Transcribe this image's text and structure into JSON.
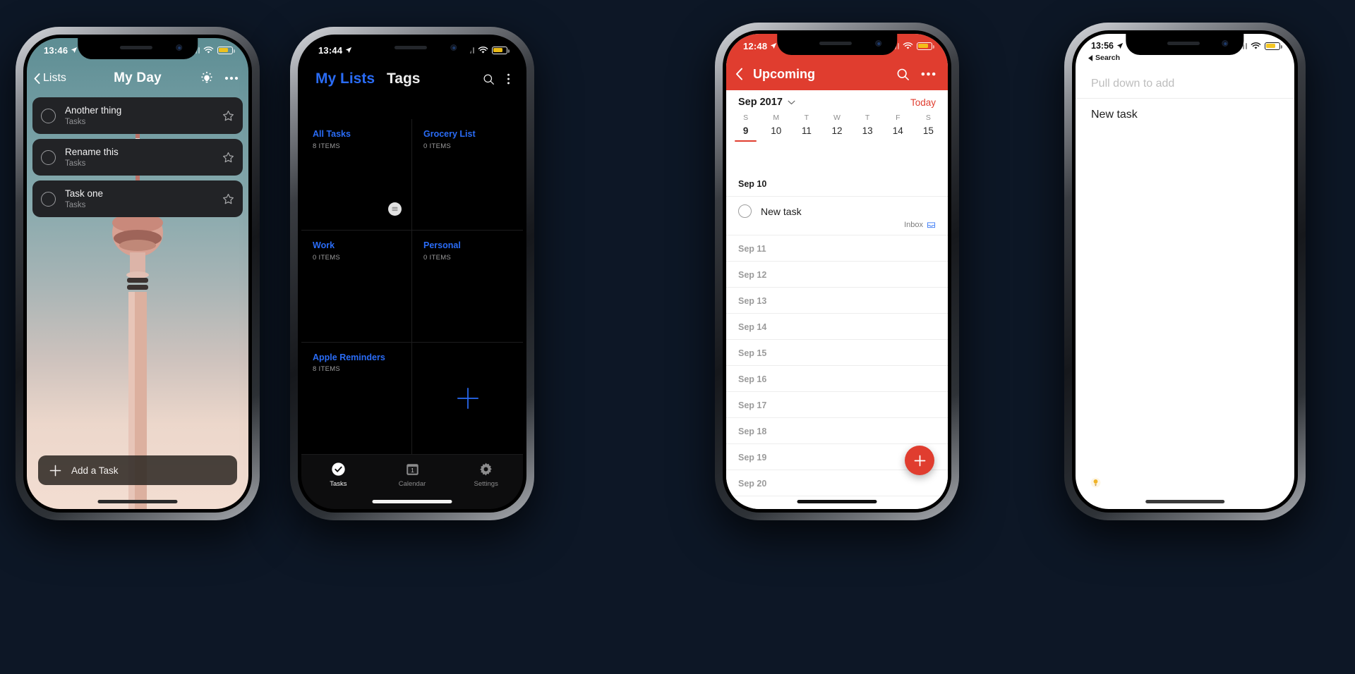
{
  "phones": {
    "phone1": {
      "name": "my-day-dark-theme",
      "status": {
        "time": "13:46",
        "location_icon": "location-arrow-icon",
        "wifi_icon": "wifi-icon",
        "battery_icon": "battery-icon"
      },
      "header": {
        "back_label": "Lists",
        "title": "My Day",
        "bulb_icon": "lightbulb-icon",
        "more_icon": "ellipsis-icon"
      },
      "tasks": [
        {
          "name": "Another thing",
          "list": "Tasks",
          "star_icon": "star-outline-icon",
          "checkbox_icon": "circle-checkbox-icon"
        },
        {
          "name": "Rename this",
          "list": "Tasks",
          "star_icon": "star-outline-icon",
          "checkbox_icon": "circle-checkbox-icon"
        },
        {
          "name": "Task one",
          "list": "Tasks",
          "star_icon": "star-outline-icon",
          "checkbox_icon": "circle-checkbox-icon"
        }
      ],
      "add_button": {
        "label": "Add a Task",
        "icon": "plus-icon"
      },
      "colors": {
        "sky_top": "#5d8d93",
        "sky_bottom": "#f3ded2",
        "card": "#222326"
      }
    },
    "phone2": {
      "name": "my-lists-grid",
      "status": {
        "time": "13:44",
        "location_icon": "location-arrow-icon",
        "wifi_icon": "wifi-icon",
        "battery_icon": "battery-icon"
      },
      "header": {
        "tabs": [
          {
            "label": "My Lists",
            "active": true
          },
          {
            "label": "Tags",
            "active": false
          }
        ],
        "search_icon": "search-icon",
        "overflow_icon": "kebab-menu-icon"
      },
      "lists": [
        {
          "name": "All Tasks",
          "count": "8 ITEMS"
        },
        {
          "name": "Grocery List",
          "count": "0 ITEMS"
        },
        {
          "name": "Work",
          "count": "0 ITEMS"
        },
        {
          "name": "Personal",
          "count": "0 ITEMS"
        },
        {
          "name": "Apple Reminders",
          "count": "8 ITEMS"
        }
      ],
      "add_list_icon": "plus-icon",
      "badge_icon": "inbox-badge-icon",
      "tabbar": [
        {
          "label": "Tasks",
          "icon": "check-circle-icon",
          "active": true
        },
        {
          "label": "Calendar",
          "icon": "calendar-icon",
          "active": false
        },
        {
          "label": "Settings",
          "icon": "gear-icon",
          "active": false
        }
      ],
      "colors": {
        "accent": "#2a6cf6",
        "bg": "#000000"
      }
    },
    "phone3": {
      "name": "upcoming-calendar",
      "status": {
        "time": "12:48",
        "location_icon": "location-arrow-icon",
        "wifi_icon": "wifi-icon",
        "battery_icon": "battery-icon"
      },
      "nav": {
        "back_icon": "chevron-left-icon",
        "title": "Upcoming",
        "search_icon": "search-icon",
        "more_icon": "ellipsis-icon"
      },
      "calendar": {
        "month": "Sep 2017",
        "chevron_icon": "chevron-down-icon",
        "today_label": "Today",
        "day_initials": [
          "S",
          "M",
          "T",
          "W",
          "T",
          "F",
          "S"
        ],
        "dates": [
          "9",
          "10",
          "11",
          "12",
          "13",
          "14",
          "15"
        ],
        "selected_date": "9"
      },
      "days": [
        {
          "label": "Sep 10",
          "strong": true,
          "tasks": [
            {
              "name": "New task",
              "meta": "Inbox",
              "meta_icon": "inbox-icon",
              "checkbox_icon": "circle-checkbox-icon"
            }
          ]
        },
        {
          "label": "Sep 11",
          "strong": false,
          "tasks": []
        },
        {
          "label": "Sep 12",
          "strong": false,
          "tasks": []
        },
        {
          "label": "Sep 13",
          "strong": false,
          "tasks": []
        },
        {
          "label": "Sep 14",
          "strong": false,
          "tasks": []
        },
        {
          "label": "Sep 15",
          "strong": false,
          "tasks": []
        },
        {
          "label": "Sep 16",
          "strong": false,
          "tasks": []
        },
        {
          "label": "Sep 17",
          "strong": false,
          "tasks": []
        },
        {
          "label": "Sep 18",
          "strong": false,
          "tasks": []
        },
        {
          "label": "Sep 19",
          "strong": false,
          "tasks": []
        },
        {
          "label": "Sep 20",
          "strong": false,
          "tasks": []
        }
      ],
      "fab": {
        "icon": "plus-icon"
      },
      "colors": {
        "accent": "#e03d2f",
        "bg": "#ffffff"
      }
    },
    "phone4": {
      "name": "today-widget-light",
      "status": {
        "time": "13:56",
        "location_icon": "location-arrow-icon",
        "wifi_icon": "wifi-icon",
        "battery_icon": "battery-icon"
      },
      "back_label": "Search",
      "back_icon": "back-triangle-icon",
      "pull_placeholder": "Pull down to add",
      "tasks": [
        {
          "name": "New task"
        }
      ],
      "bulb_icon": "lightbulb-icon",
      "colors": {
        "bg": "#ffffff",
        "placeholder": "#bdbdbd"
      }
    }
  }
}
